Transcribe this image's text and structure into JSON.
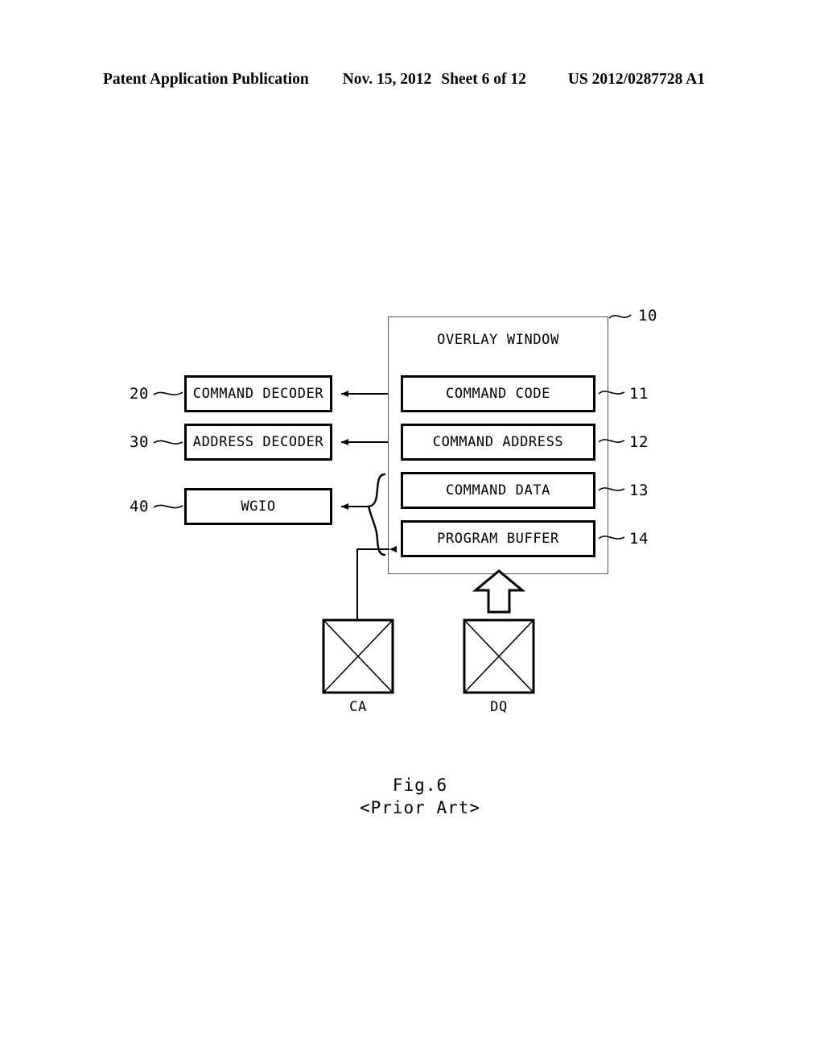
{
  "header": {
    "publication": "Patent Application Publication",
    "date": "Nov. 15, 2012",
    "sheet": "Sheet 6 of 12",
    "patent_number": "US 2012/0287728 A1"
  },
  "figure": {
    "caption_line1": "Fig.6",
    "caption_line2": "<Prior Art>"
  },
  "overlay_window": {
    "title": "OVERLAY WINDOW",
    "ref": "10",
    "items": [
      {
        "label": "COMMAND CODE",
        "ref": "11"
      },
      {
        "label": "COMMAND ADDRESS",
        "ref": "12"
      },
      {
        "label": "COMMAND DATA",
        "ref": "13"
      },
      {
        "label": "PROGRAM BUFFER",
        "ref": "14"
      }
    ]
  },
  "left_blocks": [
    {
      "label": "COMMAND DECODER",
      "ref": "20"
    },
    {
      "label": "ADDRESS DECODER",
      "ref": "30"
    },
    {
      "label": "WGIO",
      "ref": "40"
    }
  ],
  "pads": [
    {
      "label": "CA"
    },
    {
      "label": "DQ"
    }
  ],
  "colors": {
    "ink": "#000000",
    "thin_line": "#555555",
    "background": "#ffffff"
  }
}
